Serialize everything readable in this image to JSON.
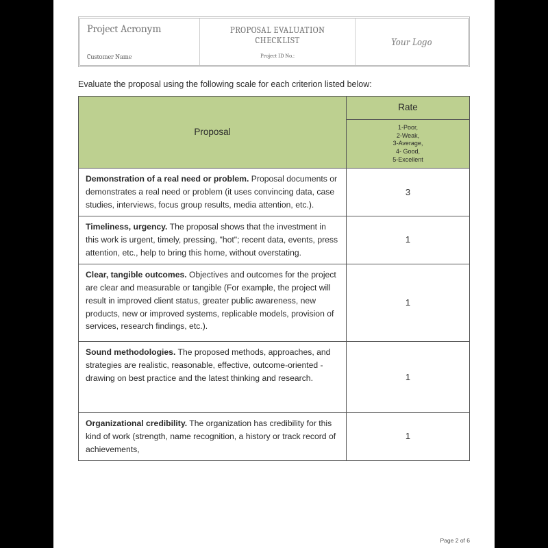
{
  "header": {
    "acronym": "Project Acronym",
    "customer": "Customer Name",
    "title": "PROPOSAL EVALUATION CHECKLIST",
    "project_id_label": "Project ID No.:",
    "logo_text": "Your Logo"
  },
  "instruction": "Evaluate the proposal using the following scale for each criterion listed below:",
  "table": {
    "col_proposal": "Proposal",
    "col_rate": "Rate",
    "scale": {
      "l1": "1-Poor,",
      "l2": "2-Weak,",
      "l3": "3-Average,",
      "l4": "4- Good,",
      "l5": "5-Excellent"
    },
    "rows": [
      {
        "title": "Demonstration of a real need or problem.",
        "desc": "  Proposal documents or demonstrates a real need or problem (it uses convincing data, case studies, interviews, focus group results, media attention, etc.).",
        "rate": "3"
      },
      {
        "title": "Timeliness, urgency.",
        "desc": "  The proposal shows that the investment in this work is urgent, timely, pressing, \"hot\"; recent data, events, press attention, etc., help to bring this home, without overstating.",
        "rate": "1"
      },
      {
        "title": "Clear, tangible outcomes.",
        "desc": "  Objectives and outcomes for the project are clear and measurable or tangible (For example, the project will result in improved client status, greater public awareness, new products, new or improved systems, replicable models, provision of services, research findings, etc.).",
        "rate": "1"
      },
      {
        "title": "Sound methodologies.",
        "desc": "  The proposed methods, approaches, and strategies are realistic, reasonable, effective, outcome-oriented - drawing on best practice and the latest thinking and research.",
        "rate": "1"
      },
      {
        "title": "Organizational credibility.",
        "desc": "  The organization has credibility for this kind of work (strength, name recognition, a history or track record of achievements,",
        "rate": "1"
      }
    ]
  },
  "footer": "Page 2 of 6"
}
